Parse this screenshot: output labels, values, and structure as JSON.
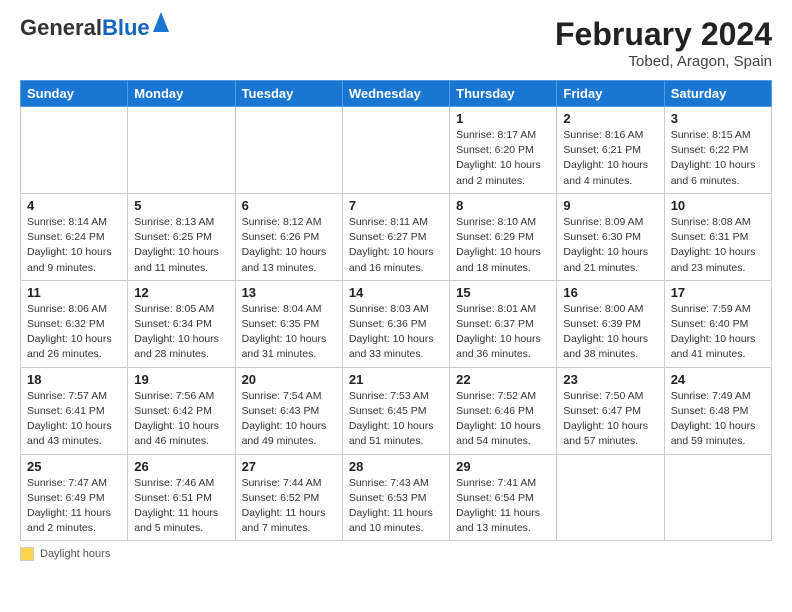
{
  "header": {
    "logo_general": "General",
    "logo_blue": "Blue",
    "main_title": "February 2024",
    "subtitle": "Tobed, Aragon, Spain"
  },
  "calendar": {
    "columns": [
      "Sunday",
      "Monday",
      "Tuesday",
      "Wednesday",
      "Thursday",
      "Friday",
      "Saturday"
    ],
    "rows": [
      [
        {
          "day": "",
          "info": ""
        },
        {
          "day": "",
          "info": ""
        },
        {
          "day": "",
          "info": ""
        },
        {
          "day": "",
          "info": ""
        },
        {
          "day": "1",
          "info": "Sunrise: 8:17 AM\nSunset: 6:20 PM\nDaylight: 10 hours\nand 2 minutes."
        },
        {
          "day": "2",
          "info": "Sunrise: 8:16 AM\nSunset: 6:21 PM\nDaylight: 10 hours\nand 4 minutes."
        },
        {
          "day": "3",
          "info": "Sunrise: 8:15 AM\nSunset: 6:22 PM\nDaylight: 10 hours\nand 6 minutes."
        }
      ],
      [
        {
          "day": "4",
          "info": "Sunrise: 8:14 AM\nSunset: 6:24 PM\nDaylight: 10 hours\nand 9 minutes."
        },
        {
          "day": "5",
          "info": "Sunrise: 8:13 AM\nSunset: 6:25 PM\nDaylight: 10 hours\nand 11 minutes."
        },
        {
          "day": "6",
          "info": "Sunrise: 8:12 AM\nSunset: 6:26 PM\nDaylight: 10 hours\nand 13 minutes."
        },
        {
          "day": "7",
          "info": "Sunrise: 8:11 AM\nSunset: 6:27 PM\nDaylight: 10 hours\nand 16 minutes."
        },
        {
          "day": "8",
          "info": "Sunrise: 8:10 AM\nSunset: 6:29 PM\nDaylight: 10 hours\nand 18 minutes."
        },
        {
          "day": "9",
          "info": "Sunrise: 8:09 AM\nSunset: 6:30 PM\nDaylight: 10 hours\nand 21 minutes."
        },
        {
          "day": "10",
          "info": "Sunrise: 8:08 AM\nSunset: 6:31 PM\nDaylight: 10 hours\nand 23 minutes."
        }
      ],
      [
        {
          "day": "11",
          "info": "Sunrise: 8:06 AM\nSunset: 6:32 PM\nDaylight: 10 hours\nand 26 minutes."
        },
        {
          "day": "12",
          "info": "Sunrise: 8:05 AM\nSunset: 6:34 PM\nDaylight: 10 hours\nand 28 minutes."
        },
        {
          "day": "13",
          "info": "Sunrise: 8:04 AM\nSunset: 6:35 PM\nDaylight: 10 hours\nand 31 minutes."
        },
        {
          "day": "14",
          "info": "Sunrise: 8:03 AM\nSunset: 6:36 PM\nDaylight: 10 hours\nand 33 minutes."
        },
        {
          "day": "15",
          "info": "Sunrise: 8:01 AM\nSunset: 6:37 PM\nDaylight: 10 hours\nand 36 minutes."
        },
        {
          "day": "16",
          "info": "Sunrise: 8:00 AM\nSunset: 6:39 PM\nDaylight: 10 hours\nand 38 minutes."
        },
        {
          "day": "17",
          "info": "Sunrise: 7:59 AM\nSunset: 6:40 PM\nDaylight: 10 hours\nand 41 minutes."
        }
      ],
      [
        {
          "day": "18",
          "info": "Sunrise: 7:57 AM\nSunset: 6:41 PM\nDaylight: 10 hours\nand 43 minutes."
        },
        {
          "day": "19",
          "info": "Sunrise: 7:56 AM\nSunset: 6:42 PM\nDaylight: 10 hours\nand 46 minutes."
        },
        {
          "day": "20",
          "info": "Sunrise: 7:54 AM\nSunset: 6:43 PM\nDaylight: 10 hours\nand 49 minutes."
        },
        {
          "day": "21",
          "info": "Sunrise: 7:53 AM\nSunset: 6:45 PM\nDaylight: 10 hours\nand 51 minutes."
        },
        {
          "day": "22",
          "info": "Sunrise: 7:52 AM\nSunset: 6:46 PM\nDaylight: 10 hours\nand 54 minutes."
        },
        {
          "day": "23",
          "info": "Sunrise: 7:50 AM\nSunset: 6:47 PM\nDaylight: 10 hours\nand 57 minutes."
        },
        {
          "day": "24",
          "info": "Sunrise: 7:49 AM\nSunset: 6:48 PM\nDaylight: 10 hours\nand 59 minutes."
        }
      ],
      [
        {
          "day": "25",
          "info": "Sunrise: 7:47 AM\nSunset: 6:49 PM\nDaylight: 11 hours\nand 2 minutes."
        },
        {
          "day": "26",
          "info": "Sunrise: 7:46 AM\nSunset: 6:51 PM\nDaylight: 11 hours\nand 5 minutes."
        },
        {
          "day": "27",
          "info": "Sunrise: 7:44 AM\nSunset: 6:52 PM\nDaylight: 11 hours\nand 7 minutes."
        },
        {
          "day": "28",
          "info": "Sunrise: 7:43 AM\nSunset: 6:53 PM\nDaylight: 11 hours\nand 10 minutes."
        },
        {
          "day": "29",
          "info": "Sunrise: 7:41 AM\nSunset: 6:54 PM\nDaylight: 11 hours\nand 13 minutes."
        },
        {
          "day": "",
          "info": ""
        },
        {
          "day": "",
          "info": ""
        }
      ]
    ]
  },
  "footer": {
    "daylight_label": "Daylight hours"
  }
}
